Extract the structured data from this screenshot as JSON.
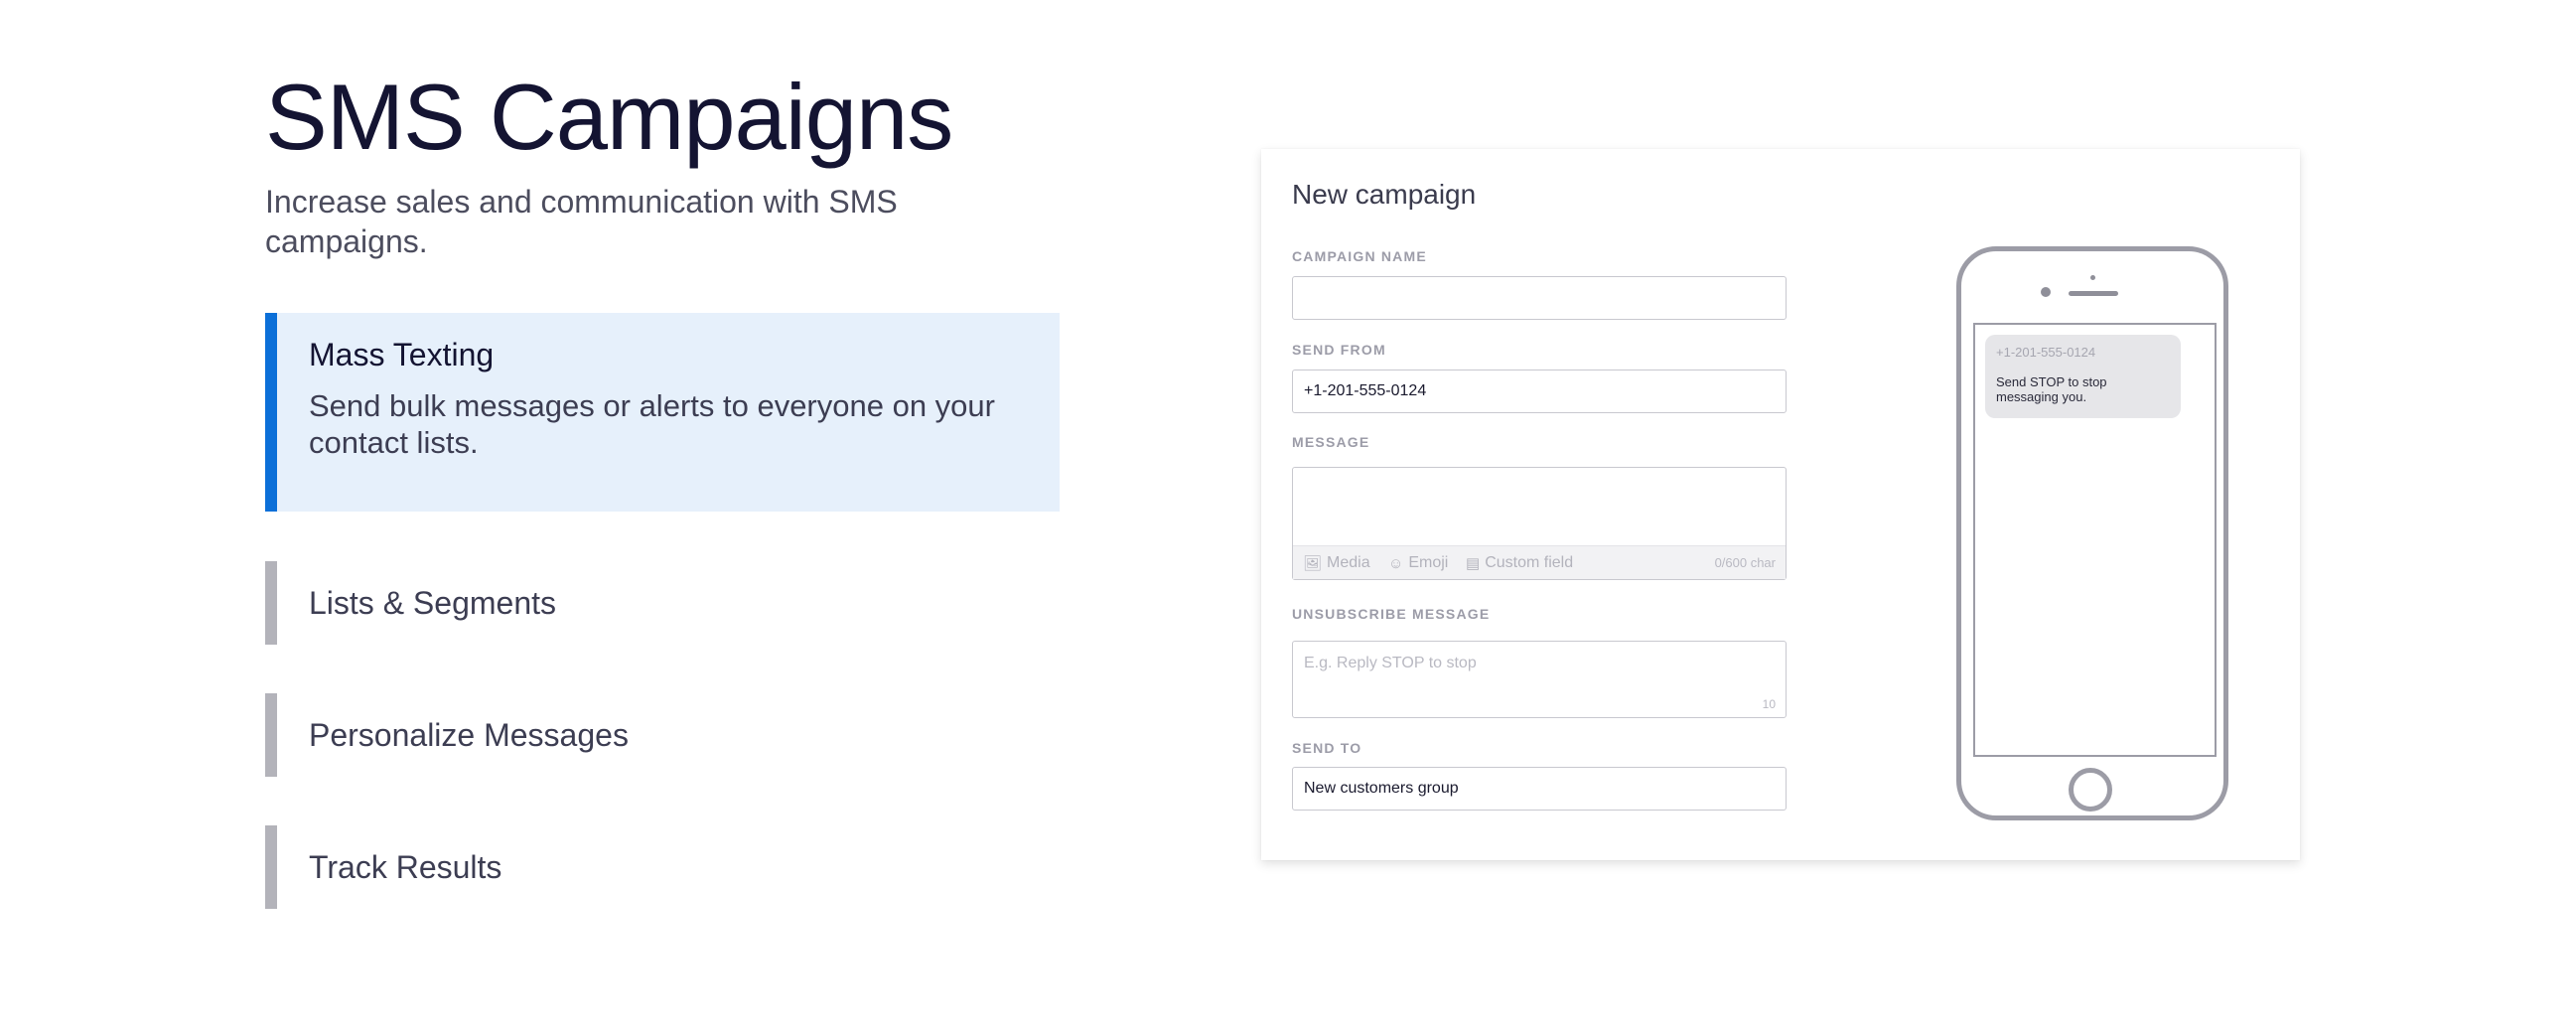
{
  "header": {
    "title": "SMS Campaigns",
    "subtitle": "Increase sales and communication with SMS campaigns."
  },
  "features": [
    {
      "title": "Mass Texting",
      "description": "Send bulk messages or alerts to everyone on your contact lists.",
      "active": true
    },
    {
      "title": "Lists & Segments",
      "active": false
    },
    {
      "title": "Personalize Messages",
      "active": false
    },
    {
      "title": "Track Results",
      "active": false
    }
  ],
  "form": {
    "title": "New campaign",
    "campaign_name": {
      "label": "CAMPAIGN NAME",
      "value": ""
    },
    "send_from": {
      "label": "SEND FROM",
      "value": "+1-201-555-0124"
    },
    "message": {
      "label": "MESSAGE",
      "value": "",
      "toolbar": {
        "media": "Media",
        "emoji": "Emoji",
        "custom_field": "Custom field"
      },
      "char_count": "0/600 char"
    },
    "unsubscribe": {
      "label": "UNSUBSCRIBE MESSAGE",
      "placeholder": "E.g. Reply STOP to stop",
      "count": "10"
    },
    "send_to": {
      "label": "SEND TO",
      "value": "New customers group"
    }
  },
  "phone_preview": {
    "from": "+1-201-555-0124",
    "message": "Send STOP to stop messaging you."
  },
  "colors": {
    "accent": "#0b6fd8",
    "active_bg": "#e6f0fb",
    "inactive_bar": "#b3b3ba"
  },
  "icons": [
    "media-icon",
    "emoji-icon",
    "custom-field-icon"
  ]
}
